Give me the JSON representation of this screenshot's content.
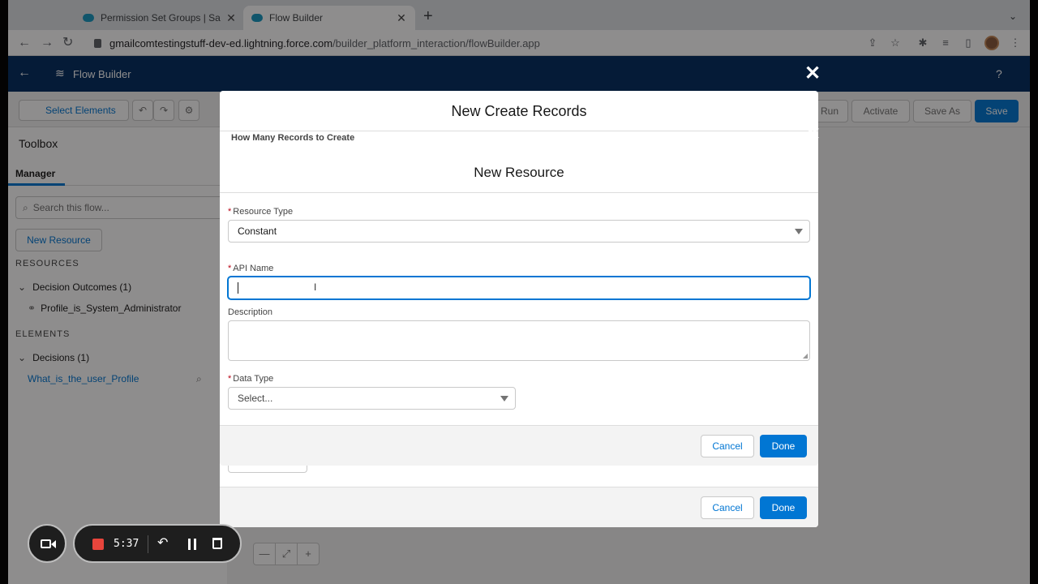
{
  "browser": {
    "tabs": [
      {
        "title": "Permission Set Groups | Salesf"
      },
      {
        "title": "Flow Builder"
      }
    ],
    "url_host": "gmailcomtestingstuff-dev-ed.lightning.force.com",
    "url_path": "/builder_platform_interaction/flowBuilder.app"
  },
  "header": {
    "title": "Flow Builder",
    "help": "?"
  },
  "toolbar": {
    "select_elements": "Select Elements",
    "run_label": "Run",
    "activate_label": "Activate",
    "save_as_label": "Save As",
    "save_label": "Save"
  },
  "sidebar": {
    "title": "Toolbox",
    "tab": "Manager",
    "search_placeholder": "Search this flow...",
    "new_resource": "New Resource",
    "resources_heading": "RESOURCES",
    "resources": [
      {
        "group": "Decision Outcomes (1)",
        "item": "Profile_is_System_Administrator"
      }
    ],
    "elements_heading": "ELEMENTS",
    "elements": [
      {
        "group": "Decisions (1)",
        "item": "What_is_the_user_Profile"
      }
    ]
  },
  "outer_modal": {
    "title": "New Create Records",
    "section_label": "How Many Records to Create",
    "cancel": "Cancel",
    "done": "Done"
  },
  "inner_modal": {
    "title": "New Resource",
    "resource_type_label": "Resource Type",
    "resource_type_value": "Constant",
    "api_name_label": "API Name",
    "api_name_value": "",
    "description_label": "Description",
    "data_type_label": "Data Type",
    "data_type_value": "Select...",
    "cancel": "Cancel",
    "done": "Done"
  },
  "recorder": {
    "time": "5:37"
  },
  "colors": {
    "brand": "#0176d3",
    "header_bg": "#032d60",
    "required": "#ba0517",
    "record": "#e8453c"
  }
}
